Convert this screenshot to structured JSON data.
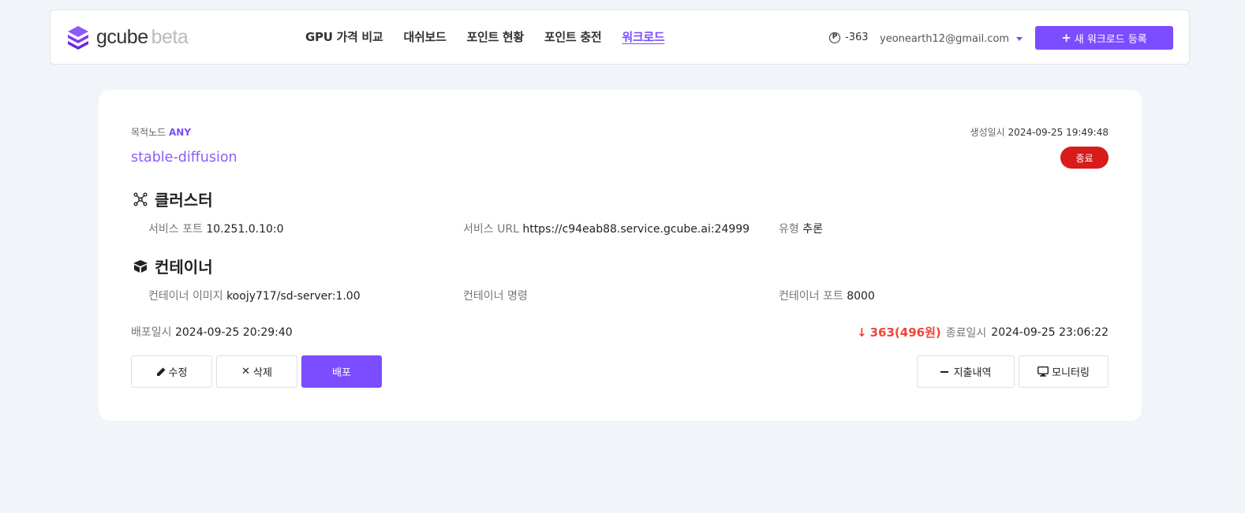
{
  "header": {
    "brand": "gcube",
    "beta": "beta",
    "nav": [
      "GPU 가격 비교",
      "대쉬보드",
      "포인트 현황",
      "포인트 충전",
      "워크로드"
    ],
    "active_nav_index": 4,
    "points_icon": "Ⓟ",
    "points": "-363",
    "email": "yeonearth12@gmail.com",
    "new_button": "새 워크로드 등록"
  },
  "workload": {
    "target_label": "목적노드",
    "target_value": "ANY",
    "created_label": "생성일시",
    "created_value": "2024-09-25 19:49:48",
    "name": "stable-diffusion",
    "status": "종료",
    "cluster_title": "클러스터",
    "service_port_label": "서비스 포트",
    "service_port_value": "10.251.0.10:0",
    "service_url_label": "서비스 URL",
    "service_url_value": "https://c94eab88.service.gcube.ai:24999",
    "type_label": "유형",
    "type_value": "추론",
    "container_title": "컨테이너",
    "image_label": "컨테이너 이미지",
    "image_value": "koojy717/sd-server:1.00",
    "command_label": "컨테이너 명령",
    "command_value": "",
    "port_label": "컨테이너 포트",
    "port_value": "8000",
    "deploy_label": "배포일시",
    "deploy_value": "2024-09-25 20:29:40",
    "cost_amount": "363(496원)",
    "end_label": "종료일시",
    "end_value": "2024-09-25 23:06:22"
  },
  "actions": {
    "edit": "수정",
    "delete": "삭제",
    "deploy": "배포",
    "spending": "지출내역",
    "monitoring": "모니터링"
  },
  "colors": {
    "accent": "#7b4dff",
    "status_red": "#d81b1b",
    "cost_red": "#f04438",
    "background": "#f1f4f8"
  }
}
